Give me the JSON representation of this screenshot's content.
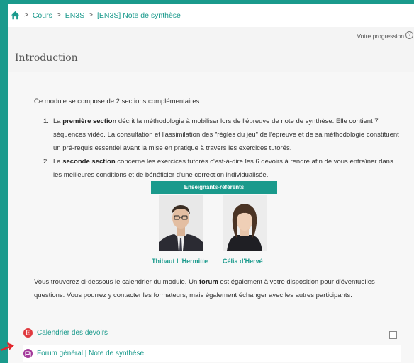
{
  "breadcrumb": {
    "items": [
      "Cours",
      "EN3S",
      "[EN3S] Note de synthèse"
    ],
    "separator": ">"
  },
  "progress": {
    "label": "Votre progression",
    "help": "?"
  },
  "section": {
    "title": "Introduction"
  },
  "intro_text": "Ce module se compose de 2 sections complémentaires :",
  "list": [
    {
      "num": "1.",
      "pre": "La ",
      "bold": "première section",
      "post": " décrit la méthodologie à mobiliser lors de l'épreuve de note de synthèse. Elle contient 7 séquences vidéo. La consultation et l'assimilation des \"règles du jeu\" de l'épreuve et de sa méthodologie constituent un pré-requis essentiel avant la mise en pratique à travers les exercices tutorés."
    },
    {
      "num": "2.",
      "pre": "La ",
      "bold": "seconde section",
      "post": " concerne les exercices tutorés c'est-à-dire les 6 devoirs à rendre afin de vous entraîner dans les meilleures conditions et de bénéficier d'une correction individualisée."
    }
  ],
  "teachers": {
    "banner": "Enseignants-référents",
    "names": [
      "Thibaut L'Hermitte",
      "Célia d'Hervé"
    ]
  },
  "paragraph": {
    "pre": "Vous trouverez ci-dessous le calendrier du module. Un ",
    "bold": "forum",
    "post": " est également à votre disposition pour d'éventuelles questions. Vous pourrez y contacter les formateurs, mais également échanger avec les autres participants."
  },
  "activities": {
    "calendar": "Calendrier des devoirs",
    "forum": "Forum général | Note de synthèse"
  },
  "colors": {
    "accent": "#1a9a8c",
    "calendar_icon": "#e0393e",
    "forum_icon": "#a3399a",
    "arrow": "#e3262c"
  },
  "icons": {
    "home": "home-icon",
    "help": "help-icon",
    "calendar": "assignment-icon",
    "forum": "forum-icon",
    "arrow": "pointer-arrow"
  }
}
